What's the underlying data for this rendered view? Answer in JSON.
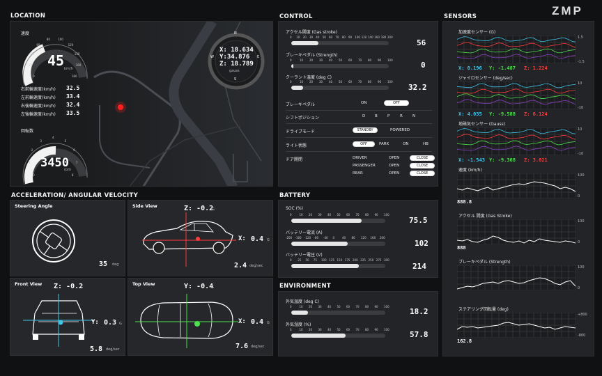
{
  "logo": "ZMP",
  "sections": {
    "location": "LOCATION",
    "control": "CONTROL",
    "sensors": "SENSORS",
    "accel": "ACCELERATION/ ANGULAR VELOCITY",
    "battery": "BATTERY",
    "environment": "ENVIRONMENT"
  },
  "location": {
    "speed_label": "速度",
    "speed_value": "45",
    "speed_unit": "km/h",
    "speed_fraction": 0.25,
    "speed_ticks": [
      "0",
      "20",
      "40",
      "60",
      "80",
      "100",
      "120",
      "140",
      "160",
      "180"
    ],
    "wheels": [
      {
        "label": "右前輪速度(km/h)",
        "value": "32.5"
      },
      {
        "label": "左前輪速度(km/h)",
        "value": "33.4"
      },
      {
        "label": "右後輪速度(km/h)",
        "value": "32.4"
      },
      {
        "label": "左後輪速度(km/h)",
        "value": "33.5"
      }
    ],
    "rpm_label": "回転数",
    "rpm_value": "3450",
    "rpm_unit": "rpm",
    "rpm_fraction": 0.5,
    "rpm_ticks": [
      "0",
      "1",
      "2",
      "3",
      "4",
      "5",
      "6",
      "7",
      "8"
    ],
    "compass": {
      "n": "N",
      "e": "E",
      "s": "S",
      "w": "W",
      "x": "X: 18.634",
      "y": "Y:34.876",
      "z": "Z: 18.789",
      "unit": "gauss"
    }
  },
  "control": {
    "accel": {
      "label": "アクセル開度 (Gas stroke)",
      "value": "56",
      "fraction": 0.28,
      "ticks": [
        "0",
        "10",
        "20",
        "30",
        "40",
        "50",
        "60",
        "70",
        "80",
        "90",
        "100",
        "120",
        "140",
        "160",
        "180",
        "200"
      ]
    },
    "brake": {
      "label": "ブレーキペダル (Strength)",
      "value": "0",
      "fraction": 0.02,
      "ticks": [
        "0",
        "10",
        "20",
        "30",
        "40",
        "50",
        "60",
        "70",
        "80",
        "90",
        "100"
      ]
    },
    "coolant": {
      "label": "クーラント温度 (deg C)",
      "value": "32.2",
      "fraction": 0.12,
      "ticks": [
        "0",
        "10",
        "20",
        "30",
        "40",
        "50",
        "60",
        "70",
        "80",
        "90",
        "100"
      ]
    },
    "brake_pedal": {
      "label": "ブレーキペダル",
      "on": "ON",
      "off": "OFF"
    },
    "shift": {
      "label": "シフトポジション",
      "options": [
        "D",
        "B",
        "P",
        "R",
        "N"
      ]
    },
    "drive": {
      "label": "ドライブモード",
      "standby": "STANDBY",
      "powered": "POWERED"
    },
    "light": {
      "label": "ライト状態",
      "options": [
        "OFF",
        "PARK",
        "ON",
        "HB"
      ]
    },
    "door": {
      "label": "ドア開閉",
      "rows": [
        {
          "name": "DRIVER",
          "state": "OPEN",
          "btn": "CLOSE"
        },
        {
          "name": "PASSENGER",
          "state": "OPEN",
          "btn": "CLOSE"
        },
        {
          "name": "REAR",
          "state": "OPEN",
          "btn": "CLOSE"
        }
      ]
    }
  },
  "battery": {
    "soc": {
      "label": "SOC (%)",
      "value": "75.5",
      "fraction": 0.75,
      "ticks": [
        "0",
        "10",
        "20",
        "30",
        "40",
        "50",
        "60",
        "70",
        "80",
        "90",
        "100"
      ]
    },
    "current": {
      "label": "バッテリー電流 (A)",
      "value": "102",
      "fraction": 0.6,
      "ticks": [
        "-200",
        "-160",
        "-120",
        "-80",
        "-40",
        "0",
        "40",
        "80",
        "120",
        "160",
        "200"
      ]
    },
    "voltage": {
      "label": "バッテリー電圧 (V)",
      "value": "214",
      "fraction": 0.72,
      "ticks": [
        "0",
        "25",
        "50",
        "75",
        "100",
        "125",
        "150",
        "175",
        "200",
        "225",
        "250",
        "275",
        "300"
      ]
    }
  },
  "environment": {
    "outtemp": {
      "label": "外気温度 (deg C)",
      "value": "18.2",
      "fraction": 0.18,
      "ticks": [
        "0",
        "10",
        "20",
        "30",
        "40",
        "50",
        "60",
        "70",
        "80",
        "90",
        "100"
      ]
    },
    "humidity": {
      "label": "外気湿度 (%)",
      "value": "57.8",
      "fraction": 0.58,
      "ticks": [
        "0",
        "10",
        "20",
        "30",
        "40",
        "50",
        "60",
        "70",
        "80",
        "90",
        "100"
      ]
    }
  },
  "accel": {
    "steering": {
      "title": "Steering Angle",
      "value": "35",
      "unit": "deg"
    },
    "side": {
      "title": "Side View",
      "z": "Z: -0.2",
      "zu": "G",
      "x": "X:",
      "xv": "0.4",
      "xu": "G",
      "rate": "2.4",
      "rate_unit": "deg/sec"
    },
    "front": {
      "title": "Front View",
      "z": "Z: -0.2",
      "zu": "G",
      "y": "Y:",
      "yv": "0.3",
      "yu": "G",
      "rate": "5.8",
      "rate_unit": "deg/sec"
    },
    "top": {
      "title": "Top View",
      "y": "Y: -0.4",
      "yu": "G",
      "x": "X:",
      "xv": "0.4",
      "xu": "G",
      "rate": "7.6",
      "rate_unit": "deg/sec"
    }
  },
  "sensors": {
    "accel": {
      "label": "加速度センサー (G)",
      "x": "X: 0.196",
      "y": "Y: -1.487",
      "z": "Z: 1.224",
      "ymax": "1.5",
      "ymin": "-1.5"
    },
    "gyro": {
      "label": "ジャイロセンサー (deg/sec)",
      "x": "X: 4.035",
      "y": "Y: -9.588",
      "z": "Z: 6.124",
      "ymax": "10",
      "ymin": "-10"
    },
    "mag": {
      "label": "地磁気センサー (Gauss)",
      "x": "X: -1.543",
      "y": "Y: -9.368",
      "z": "Z: 3.021",
      "ymax": "10",
      "ymin": "-10"
    },
    "speed": {
      "label": "速度 (km/h)",
      "value": "888.8",
      "ymax": "100",
      "ymin": "0"
    },
    "accelpedal": {
      "label": "アクセル 開度 (Gas Stroke)",
      "value": "888",
      "ymax": "100",
      "ymin": "0"
    },
    "brakepedal": {
      "label": "ブレーキペダル (Strength)",
      "ymax": "100",
      "ymin": "0"
    },
    "steer": {
      "label": "ステアリング回転量 (deg)",
      "value": "162.8",
      "ymax": "+800",
      "ymin": "-800"
    }
  },
  "colors": {
    "x": "#3fc4e8",
    "y": "#4be24b",
    "z": "#ff3b3b",
    "panel": "#222427"
  }
}
